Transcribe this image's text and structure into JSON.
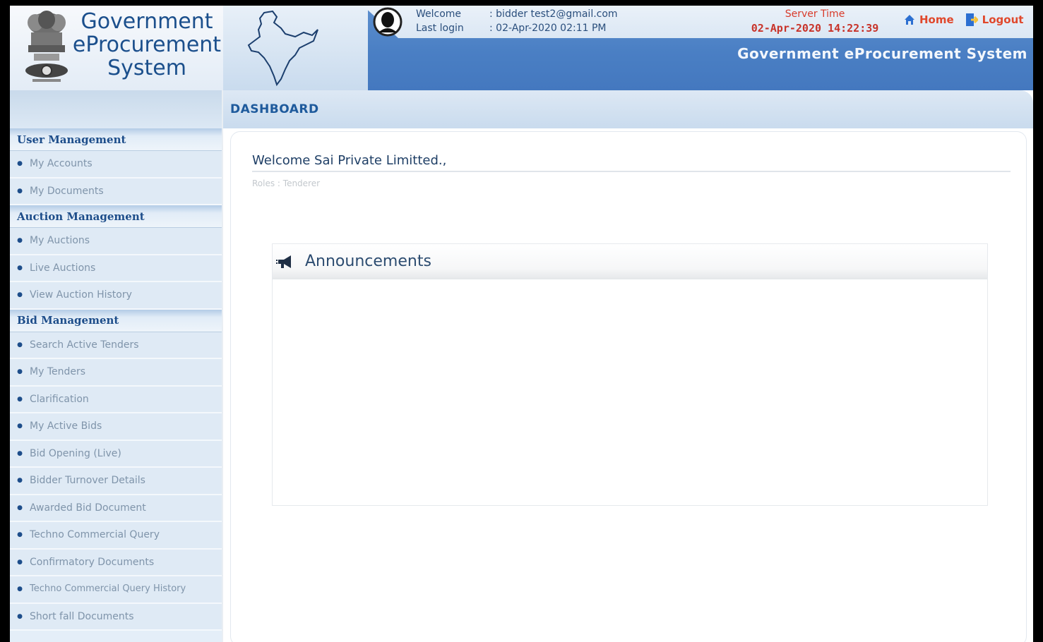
{
  "brand": {
    "title_line1": "Government",
    "title_line2": "eProcurement",
    "title_line3": "System"
  },
  "session": {
    "welcome_label": "Welcome",
    "welcome_value": ": bidder test2@gmail.com",
    "last_login_label": "Last login",
    "last_login_value": ": 02-Apr-2020 02:11 PM"
  },
  "server_time": {
    "label": "Server Time",
    "value": "02-Apr-2020 14:22:39"
  },
  "top_links": {
    "home": "Home",
    "logout": "Logout"
  },
  "system_title": "Government eProcurement System",
  "sidebar": {
    "sections": [
      {
        "title": "User Management",
        "items": [
          "My Accounts",
          "My Documents"
        ]
      },
      {
        "title": "Auction Management",
        "items": [
          "My Auctions",
          "Live Auctions",
          "View Auction History"
        ]
      },
      {
        "title": "Bid Management",
        "items": [
          "Search Active Tenders",
          "My Tenders",
          "Clarification",
          "My Active Bids",
          "Bid Opening (Live)",
          "Bidder Turnover Details",
          "Awarded Bid Document",
          "Techno Commercial Query",
          "Confirmatory Documents",
          "Techno Commercial Query History",
          "Short fall Documents"
        ]
      }
    ]
  },
  "main": {
    "heading": "DASHBOARD",
    "welcome": "Welcome Sai Private Limitted.,",
    "roles": "Roles : Tenderer",
    "announcements_title": "Announcements"
  },
  "colors": {
    "header_blue": "#4a7fc4",
    "brand_blue": "#1b4f8c",
    "alert_red": "#d83a2a"
  },
  "icons": [
    "national-emblem-icon",
    "india-map-icon",
    "user-avatar-icon",
    "home-icon",
    "logout-icon",
    "megaphone-icon"
  ]
}
